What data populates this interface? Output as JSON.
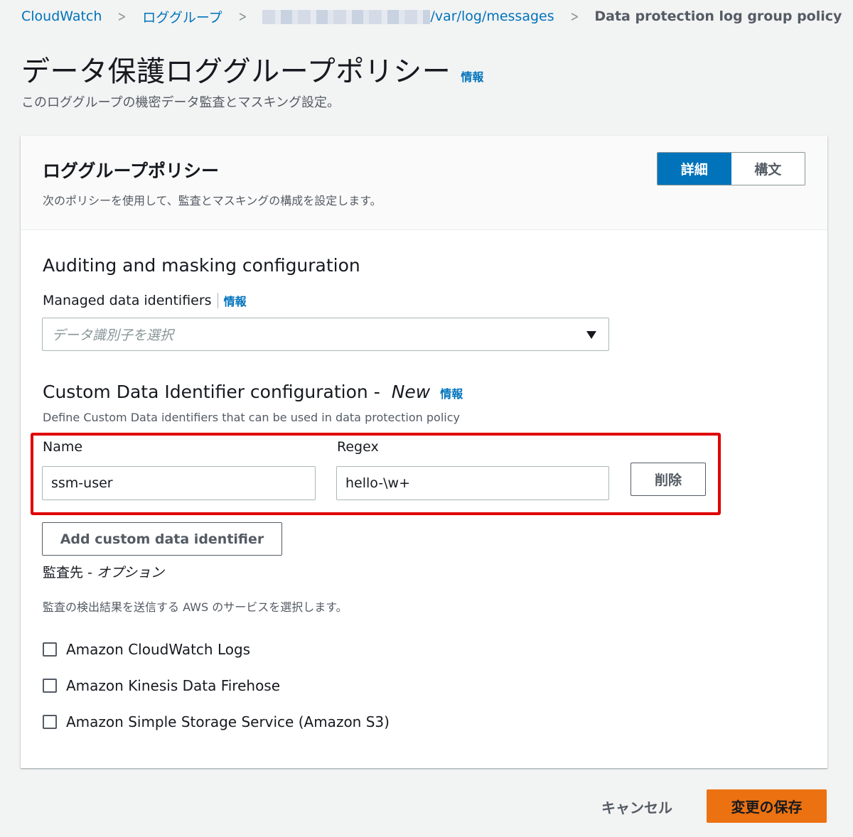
{
  "breadcrumb": {
    "items": [
      "CloudWatch",
      "ロググループ",
      "/var/log/messages"
    ],
    "current": "Data protection log group policy",
    "separator": ">"
  },
  "page": {
    "title": "データ保護ロググループポリシー",
    "info": "情報",
    "description": "このロググループの機密データ監査とマスキング設定。"
  },
  "panel": {
    "title": "ロググループポリシー",
    "description": "次のポリシーを使用して、監査とマスキングの構成を設定します。",
    "tabs": [
      "詳細",
      "構文"
    ],
    "active_tab": "詳細"
  },
  "auditing": {
    "heading": "Auditing and masking configuration",
    "managed_label": "Managed data identifiers",
    "info": "情報",
    "select_placeholder": "データ識別子を選択"
  },
  "custom": {
    "heading": "Custom Data Identifier configuration - ",
    "heading_new": "New",
    "info": "情報",
    "description": "Define Custom Data identifiers that can be used in data protection policy",
    "name_label": "Name",
    "regex_label": "Regex",
    "name_value": "ssm-user",
    "regex_value": "hello-\\w+",
    "delete_label": "削除",
    "add_label": "Add custom data identifier"
  },
  "destination": {
    "label": "監査先 - ",
    "optional": "オプション",
    "description": "監査の検出結果を送信する AWS のサービスを選択します。",
    "options": [
      "Amazon CloudWatch Logs",
      "Amazon Kinesis Data Firehose",
      "Amazon Simple Storage Service (Amazon S3)"
    ]
  },
  "footer": {
    "cancel": "キャンセル",
    "save": "変更の保存"
  },
  "colors": {
    "link": "#0073bb",
    "primary": "#ec7211",
    "highlight": "#e00000"
  }
}
